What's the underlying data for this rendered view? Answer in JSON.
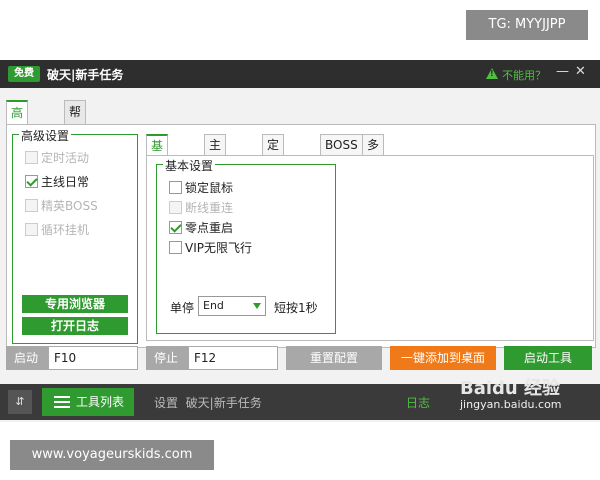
{
  "overlays": {
    "tg": "TG: MYYJJPP",
    "site": "www.voyageurskids.com"
  },
  "titlebar": {
    "free_badge": "免费",
    "title": "破天|新手任务",
    "cant_use": "不能用？",
    "help": "?",
    "minimize": "—",
    "close": "✕"
  },
  "outer_tabs": [
    "高级设置",
    "帮助说明"
  ],
  "advanced_group": {
    "legend": "高级设置",
    "items": [
      {
        "label": "定时活动",
        "checked": false,
        "disabled": true
      },
      {
        "label": "主线日常",
        "checked": true,
        "disabled": false
      },
      {
        "label": "精英BOSS",
        "checked": false,
        "disabled": true
      },
      {
        "label": "循环挂机",
        "checked": false,
        "disabled": true
      }
    ],
    "browser_button": "专用浏览器",
    "log_button": "打开日志"
  },
  "inner_tabs": [
    "基本设置",
    "主线日常",
    "定时活动",
    "BOSS",
    "多人副本"
  ],
  "basic_group": {
    "legend": "基本设置",
    "items": [
      {
        "label": "锁定鼠标",
        "checked": false,
        "disabled": false
      },
      {
        "label": "断线重连",
        "checked": false,
        "disabled": true
      },
      {
        "label": "零点重启",
        "checked": true,
        "disabled": false
      },
      {
        "label": "VIP无限飞行",
        "checked": false,
        "disabled": false
      }
    ],
    "stop_label": "单停",
    "stop_key": "End",
    "short_press": "短按1秒"
  },
  "controls": {
    "start_label": "启动",
    "start_key": "F10",
    "stop_label": "停止",
    "stop_key": "F12",
    "reset": "重置配置",
    "add_desktop": "一键添加到桌面",
    "launch": "启动工具"
  },
  "footer": {
    "expand": "⇵",
    "tool_list": "工具列表",
    "settings_prefix": "设置",
    "settings_value": "破天|新手任务",
    "log": "日志"
  },
  "watermark": {
    "brand": "Baidu 经验",
    "url": "jingyan.baidu.com"
  },
  "colors": {
    "accent": "#2f9a2f",
    "titlebar": "#2e2e2e",
    "orange": "#f07a1a",
    "gray_button": "#a8a8a8"
  }
}
